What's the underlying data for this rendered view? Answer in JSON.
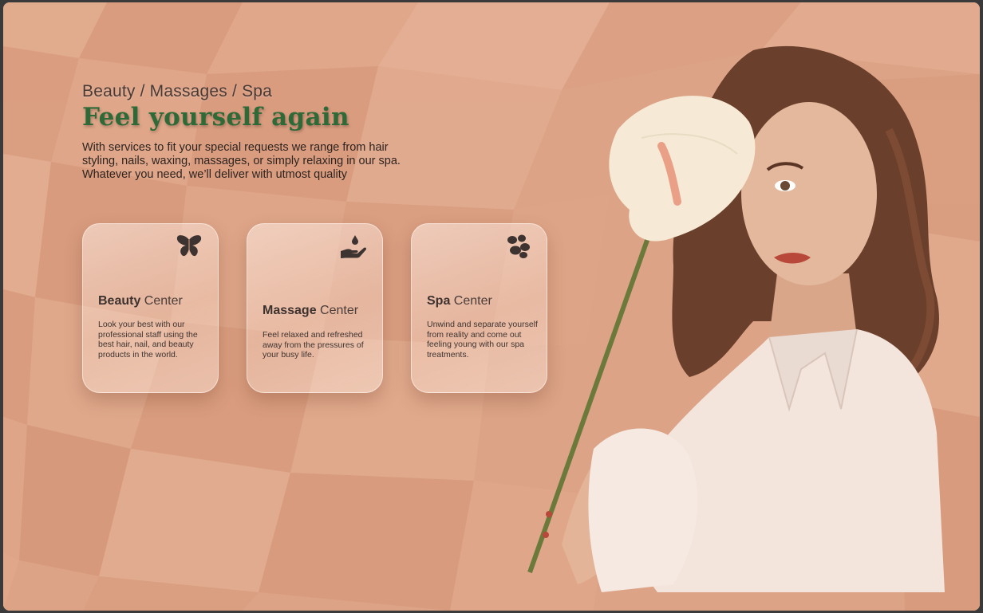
{
  "hero": {
    "breadcrumb": "Beauty / Massages / Spa",
    "headline": "Feel yourself again",
    "description": "With services to fit your special requests we range from hair styling, nails, waxing, massages, or simply relaxing in our spa. Whatever you need, we’ll deliver with utmost quality"
  },
  "cards": [
    {
      "title_bold": "Beauty",
      "title_rest": " Center",
      "text": "Look your best with our professional staff using the best hair, nail, and beauty products in the world.",
      "icon": "butterfly-icon"
    },
    {
      "title_bold": "Massage",
      "title_rest": " Center",
      "text": "Feel relaxed and refreshed away from the pressures of your busy life.",
      "icon": "hand-droplet-icon"
    },
    {
      "title_bold": "Spa",
      "title_rest": " Center",
      "text": "Unwind and separate yourself from reality and come out feeling young with our spa treatments.",
      "icon": "stones-icon"
    }
  ],
  "colors": {
    "background": "#dca386",
    "headline": "#2d6a37",
    "card_glass": "#f7ddd0"
  }
}
